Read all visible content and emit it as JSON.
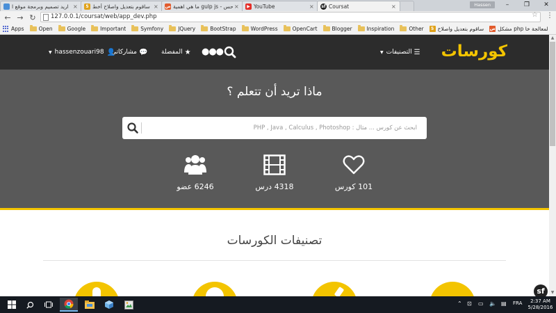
{
  "browser": {
    "tabs": [
      {
        "title": "ارید تصمیم وبرمجة موقع ا",
        "icon_color": "#4a8fd8",
        "icon_glyph": "",
        "active": false
      },
      {
        "title": "ساقوم بتعديل واصلاح أخط",
        "icon_color": "#e0a21a",
        "icon_glyph": "5",
        "active": false
      },
      {
        "title": "ما هي اهمية gulp js - حس",
        "icon_color": "#e25b2c",
        "icon_glyph": "ص",
        "active": false
      },
      {
        "title": "YouTube",
        "icon_color": "#e52d27",
        "icon_glyph": "▶",
        "active": false
      },
      {
        "title": "Coursat",
        "icon_color": "#222222",
        "icon_glyph": "sf",
        "active": true
      }
    ],
    "user_badge": "Hassen",
    "window_controls": {
      "minimize": "–",
      "restore": "❐",
      "close": "✕"
    },
    "nav": {
      "back": "←",
      "forward": "→",
      "reload": "↻"
    },
    "url": "127.0.0.1/coursat/web/app_dev.php",
    "bookmarks": [
      {
        "label": "Apps",
        "kind": "apps"
      },
      {
        "label": "Open",
        "kind": "folder"
      },
      {
        "label": "Google",
        "kind": "folder"
      },
      {
        "label": "Important",
        "kind": "folder"
      },
      {
        "label": "Symfony",
        "kind": "folder"
      },
      {
        "label": "JQuery",
        "kind": "folder"
      },
      {
        "label": "BootStrap",
        "kind": "folder"
      },
      {
        "label": "WordPress",
        "kind": "folder"
      },
      {
        "label": "OpenCart",
        "kind": "folder"
      },
      {
        "label": "Blogger",
        "kind": "folder"
      },
      {
        "label": "Inspiration",
        "kind": "folder"
      },
      {
        "label": "Other",
        "kind": "folder"
      },
      {
        "label": "ساقوم بتعديل واصلاح",
        "kind": "fav5"
      },
      {
        "label": "مشكل php لمعالجة خا",
        "kind": "favs"
      }
    ]
  },
  "site": {
    "logo": "كورسات",
    "nav": {
      "categories": "التصنيفات",
      "user": "hassenzouari98",
      "posts": "مشاركاتي",
      "favorites": "المفضلة"
    },
    "hero": {
      "title": "ماذا تريد أن تتعلم ؟",
      "search_placeholder": "ابحث عن كورس ... مثال : PHP , Java , Calculus , Photoshop",
      "stats": {
        "courses": "101 كورس",
        "lessons": "4318 درس",
        "members": "6246 عضو"
      }
    },
    "categories_title": "تصنيفات الكورسات"
  },
  "taskbar": {
    "language": "FRA",
    "time": "2:37 AM",
    "date": "5/28/2016"
  },
  "colors": {
    "accent": "#f3c400",
    "header_bg": "#2c2c2c",
    "hero_bg": "#595959"
  }
}
